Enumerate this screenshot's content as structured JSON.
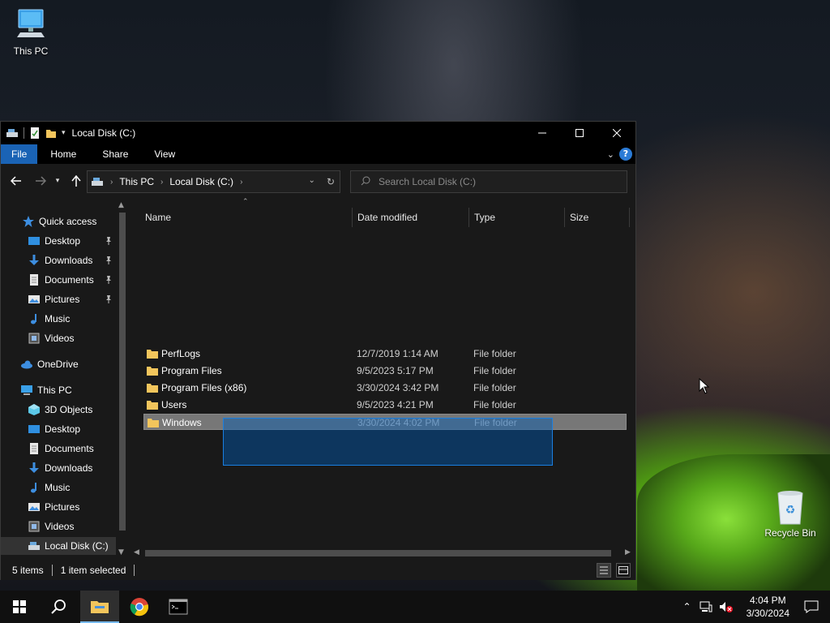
{
  "desktop": {
    "this_pc_label": "This PC",
    "recycle_bin_label": "Recycle Bin"
  },
  "window": {
    "title": "Local Disk (C:)",
    "ribbon_tabs": [
      "File",
      "Home",
      "Share",
      "View"
    ],
    "breadcrumb": [
      "This PC",
      "Local Disk (C:)"
    ],
    "search_placeholder": "Search Local Disk (C:)",
    "columns": [
      "Name",
      "Date modified",
      "Type",
      "Size"
    ],
    "rows": [
      {
        "name": "PerfLogs",
        "date": "12/7/2019 1:14 AM",
        "type": "File folder",
        "selected": false
      },
      {
        "name": "Program Files",
        "date": "9/5/2023 5:17 PM",
        "type": "File folder",
        "selected": false
      },
      {
        "name": "Program Files (x86)",
        "date": "3/30/2024 3:42 PM",
        "type": "File folder",
        "selected": false
      },
      {
        "name": "Users",
        "date": "9/5/2023 4:21 PM",
        "type": "File folder",
        "selected": false
      },
      {
        "name": "Windows",
        "date": "3/30/2024 4:02 PM",
        "type": "File folder",
        "selected": true
      }
    ],
    "status_items": "5 items",
    "status_selected": "1 item selected"
  },
  "navpane": {
    "quick_access": "Quick access",
    "quick_items": [
      {
        "label": "Desktop",
        "icon": "desktop-icon",
        "pinned": true
      },
      {
        "label": "Downloads",
        "icon": "downloads-icon",
        "pinned": true
      },
      {
        "label": "Documents",
        "icon": "documents-icon",
        "pinned": true
      },
      {
        "label": "Pictures",
        "icon": "pictures-icon",
        "pinned": true
      },
      {
        "label": "Music",
        "icon": "music-icon",
        "pinned": false
      },
      {
        "label": "Videos",
        "icon": "videos-icon",
        "pinned": false
      }
    ],
    "onedrive": "OneDrive",
    "this_pc": "This PC",
    "pc_items": [
      {
        "label": "3D Objects",
        "icon": "3d-objects-icon"
      },
      {
        "label": "Desktop",
        "icon": "desktop-icon"
      },
      {
        "label": "Documents",
        "icon": "documents-icon"
      },
      {
        "label": "Downloads",
        "icon": "downloads-icon"
      },
      {
        "label": "Music",
        "icon": "music-icon"
      },
      {
        "label": "Pictures",
        "icon": "pictures-icon"
      },
      {
        "label": "Videos",
        "icon": "videos-icon"
      },
      {
        "label": "Local Disk (C:)",
        "icon": "drive-icon",
        "selected": true
      }
    ]
  },
  "taskbar": {
    "time": "4:04 PM",
    "date": "3/30/2024"
  },
  "colors": {
    "accent": "#1a63b5",
    "folder": "#f2c55c"
  }
}
